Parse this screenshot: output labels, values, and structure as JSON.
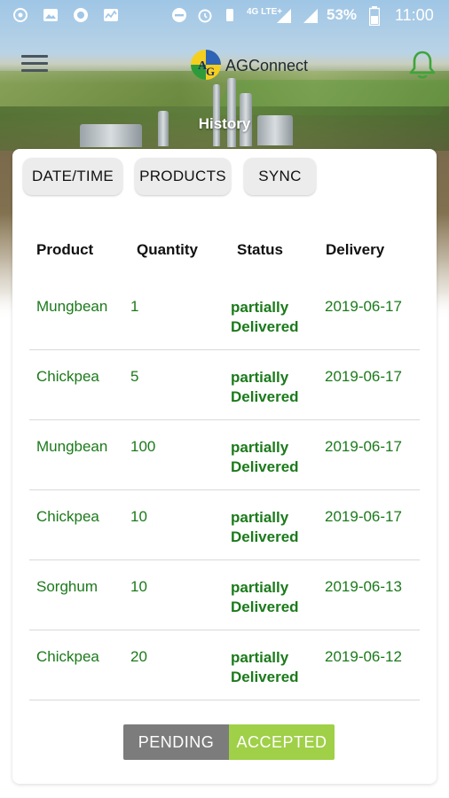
{
  "status_bar": {
    "battery": "53%",
    "time": "11:00",
    "network": "4G LTE+",
    "icons": [
      "sync-icon",
      "image-icon",
      "circle-icon",
      "activity-icon",
      "dnd-icon",
      "alarm-icon",
      "signal-icon",
      "signal-icon",
      "battery-icon"
    ]
  },
  "app_bar": {
    "brand": "AGConnect",
    "menu_icon": "hamburger-menu-icon",
    "notification_icon": "bell-icon"
  },
  "page": {
    "title": "History"
  },
  "filters": {
    "date_time": "DATE/TIME",
    "products": "PRODUCTS",
    "sync": "SYNC"
  },
  "table": {
    "headers": {
      "product": "Product",
      "quantity": "Quantity",
      "status": "Status",
      "delivery": "Delivery"
    },
    "rows": [
      {
        "product": "Mungbean",
        "quantity": "1",
        "status_line1": "partially",
        "status_line2": "Delivered",
        "delivery": "2019-06-17"
      },
      {
        "product": "Chickpea",
        "quantity": "5",
        "status_line1": "partially",
        "status_line2": "Delivered",
        "delivery": "2019-06-17"
      },
      {
        "product": "Mungbean",
        "quantity": "100",
        "status_line1": "partially",
        "status_line2": "Delivered",
        "delivery": "2019-06-17"
      },
      {
        "product": "Chickpea",
        "quantity": "10",
        "status_line1": "partially",
        "status_line2": "Delivered",
        "delivery": "2019-06-17"
      },
      {
        "product": "Sorghum",
        "quantity": "10",
        "status_line1": "partially",
        "status_line2": "Delivered",
        "delivery": "2019-06-13"
      },
      {
        "product": "Chickpea",
        "quantity": "20",
        "status_line1": "partially",
        "status_line2": "Delivered",
        "delivery": "2019-06-12"
      }
    ]
  },
  "toggle": {
    "pending": "PENDING",
    "accepted": "ACCEPTED",
    "selected": "ACCEPTED"
  },
  "colors": {
    "row_text": "#1b7a1b",
    "accepted": "#9fd048",
    "pending": "#7c7c7c",
    "bell": "#3fa43a"
  }
}
